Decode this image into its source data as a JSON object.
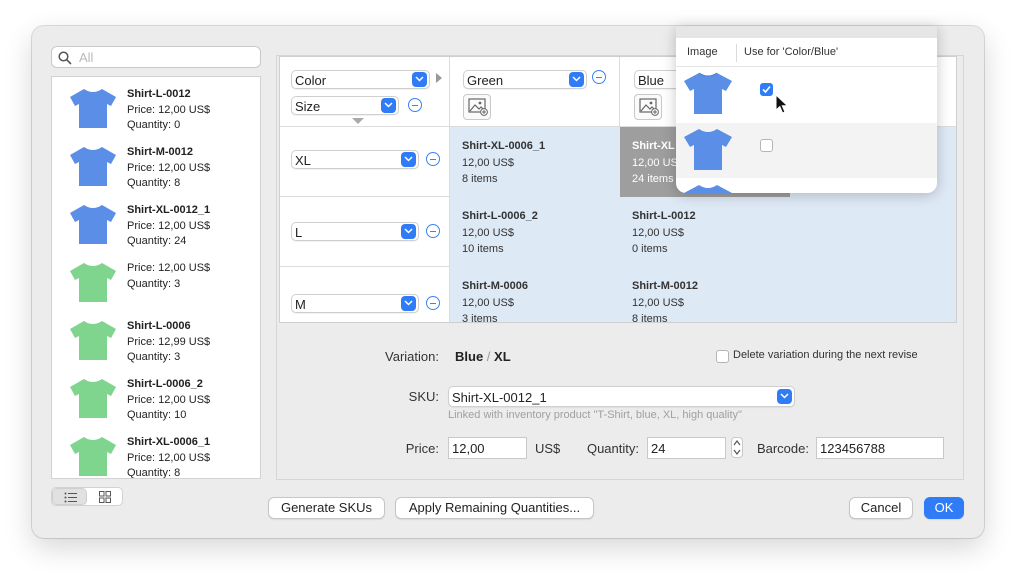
{
  "colors": {
    "accent": "#2f7cf6",
    "blue_shirt": "#5b8ee6",
    "green_shirt": "#7fd48e",
    "cell_bg": "#dee9f6",
    "selected_cell": "#9e9e9e"
  },
  "search": {
    "placeholder": "All"
  },
  "products": [
    {
      "name": "Shirt-L-0012",
      "price": "Price: 12,00 US$",
      "quantity": "Quantity: 0",
      "shirt_color": "blue"
    },
    {
      "name": "Shirt-M-0012",
      "price": "Price: 12,00 US$",
      "quantity": "Quantity: 8",
      "shirt_color": "blue"
    },
    {
      "name": "Shirt-XL-0012_1",
      "price": "Price: 12,00 US$",
      "quantity": "Quantity: 24",
      "shirt_color": "blue"
    },
    {
      "name": "",
      "price": "Price: 12,00 US$",
      "quantity": "Quantity: 3",
      "shirt_color": "green"
    },
    {
      "name": "Shirt-L-0006",
      "price": "Price: 12,99 US$",
      "quantity": "Quantity: 3",
      "shirt_color": "green"
    },
    {
      "name": "Shirt-L-0006_2",
      "price": "Price: 12,00 US$",
      "quantity": "Quantity: 10",
      "shirt_color": "green"
    },
    {
      "name": "Shirt-XL-0006_1",
      "price": "Price: 12,00 US$",
      "quantity": "Quantity: 8",
      "shirt_color": "green"
    }
  ],
  "matrix": {
    "attribute_col": "Color",
    "attribute_row": "Size",
    "columns": [
      {
        "label": "Green"
      },
      {
        "label": "Blue"
      }
    ],
    "rows": [
      {
        "label": "XL"
      },
      {
        "label": "L"
      },
      {
        "label": "M"
      }
    ],
    "cells": [
      {
        "row": 0,
        "col": 0,
        "name": "Shirt-XL-0006_1",
        "price": "12,00 US$",
        "items": "8 items"
      },
      {
        "row": 0,
        "col": 1,
        "name": "Shirt-XL",
        "price": "12,00 US$",
        "items": "24 items",
        "selected": true
      },
      {
        "row": 1,
        "col": 0,
        "name": "Shirt-L-0006_2",
        "price": "12,00 US$",
        "items": "10 items"
      },
      {
        "row": 1,
        "col": 1,
        "name": "Shirt-L-0012",
        "price": "12,00 US$",
        "items": "0 items"
      },
      {
        "row": 2,
        "col": 0,
        "name": "Shirt-M-0006",
        "price": "12,00 US$",
        "items": "3 items"
      },
      {
        "row": 2,
        "col": 1,
        "name": "Shirt-M-0012",
        "price": "12,00 US$",
        "items": "8 items"
      }
    ]
  },
  "popover": {
    "col_image": "Image",
    "col_use": "Use for 'Color/Blue'",
    "rows": [
      {
        "checked": true
      },
      {
        "checked": false
      }
    ]
  },
  "detail": {
    "variation_label": "Variation:",
    "variation_color": "Blue",
    "variation_sep": "/",
    "variation_size": "XL",
    "delete_label": "Delete variation during the next revise",
    "delete_checked": false,
    "sku_label": "SKU:",
    "sku_value": "Shirt-XL-0012_1",
    "sku_hint": "Linked with inventory product \"T-Shirt, blue, XL, high quality\"",
    "price_label": "Price:",
    "price_value": "12,00",
    "currency": "US$",
    "quantity_label": "Quantity:",
    "quantity_value": "24",
    "barcode_label": "Barcode:",
    "barcode_value": "123456788"
  },
  "buttons": {
    "generate_skus": "Generate SKUs",
    "apply_remaining": "Apply Remaining Quantities...",
    "cancel": "Cancel",
    "ok": "OK"
  }
}
